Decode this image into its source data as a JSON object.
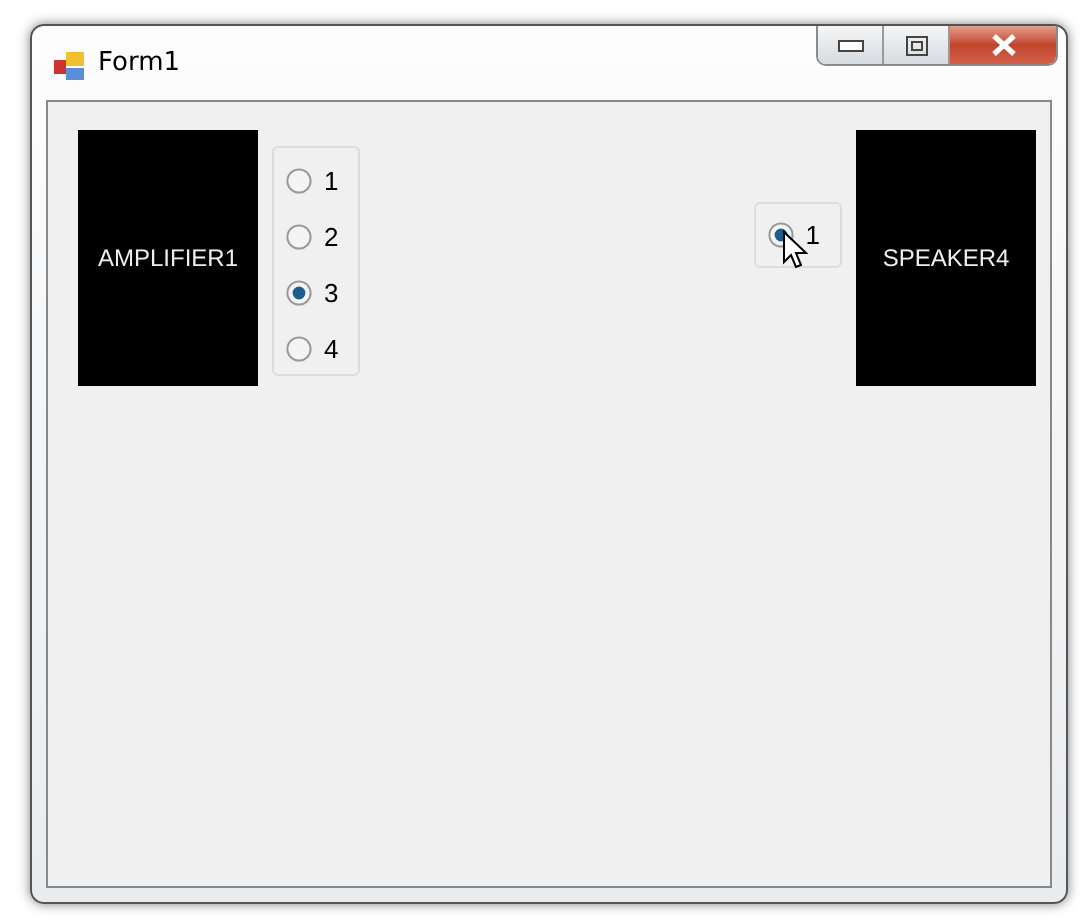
{
  "window": {
    "title": "Form1"
  },
  "amplifier": {
    "label": "AMPLIFIER1"
  },
  "amplifier_radios": [
    {
      "label": "1",
      "selected": false
    },
    {
      "label": "2",
      "selected": false
    },
    {
      "label": "3",
      "selected": true
    },
    {
      "label": "4",
      "selected": false
    }
  ],
  "speaker_radios": [
    {
      "label": "1",
      "selected": true
    }
  ],
  "speaker": {
    "label": "SPEAKER4"
  }
}
